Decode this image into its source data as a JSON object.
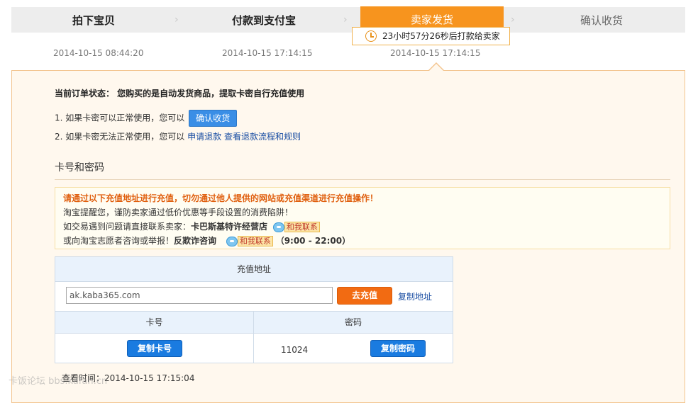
{
  "steps": [
    {
      "label": "拍下宝贝",
      "time": "2014-10-15 08:44:20"
    },
    {
      "label": "付款到支付宝",
      "time": "2014-10-15 17:14:15"
    },
    {
      "label": "卖家发货",
      "time": "2014-10-15 17:14:15"
    },
    {
      "label": "确认收货"
    }
  ],
  "countdown": "23小时57分26秒后打款给卖家",
  "order": {
    "status": "当前订单状态： 您购买的是自动发货商品，提取卡密自行充值使用",
    "line1_prefix": "1. 如果卡密可以正常使用，您可以",
    "confirm_button": "确认收货",
    "line2_prefix": "2. 如果卡密无法正常使用，您可以",
    "refund_link": "申请退款",
    "refund_rules_link": "查看退款流程和规则"
  },
  "section_title": "卡号和密码",
  "warning": {
    "headline": "请通过以下充值地址进行充值，切勿通过他人提供的网站或充值渠道进行充值操作！",
    "line2": "淘宝提醒您，谨防卖家通过低价优惠等手段设置的消费陷阱！",
    "line3_prefix": "如交易遇到问题请直接联系卖家：",
    "seller": "卡巴斯基特许经营店",
    "contact_label": "和我联系",
    "line4_prefix": "或向淘宝志愿者咨询或举报！",
    "anti_fraud": "反欺诈咨询",
    "hours": "（9:00 - 22:00）"
  },
  "table": {
    "address_header": "充值地址",
    "address_value": "ak.kaba365.com",
    "go_charge": "去充值",
    "copy_address": "复制地址",
    "card_header": "卡号",
    "password_header": "密码",
    "copy_card": "复制卡号",
    "card_number": "11024",
    "copy_password": "复制密码"
  },
  "query_time": "查看时间：2014-10-15 17:15:04",
  "watermark": "卡饭论坛 bbs.kafan.cn"
}
